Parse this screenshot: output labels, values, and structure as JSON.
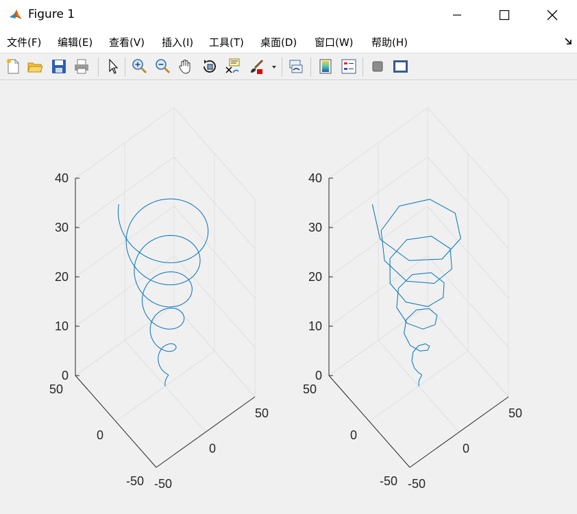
{
  "window": {
    "title": "Figure 1"
  },
  "menu": {
    "items": [
      "文件(F)",
      "编辑(E)",
      "查看(V)",
      "插入(I)",
      "工具(T)",
      "桌面(D)",
      "窗口(W)",
      "帮助(H)"
    ]
  },
  "toolbar": {
    "buttons": [
      "new-figure-icon",
      "open-file-icon",
      "save-icon",
      "print-icon",
      "select-arrow-icon",
      "zoom-in-icon",
      "zoom-out-icon",
      "pan-hand-icon",
      "rotate-3d-icon",
      "data-cursor-icon",
      "brush-icon",
      "link-plot-icon",
      "colorbar-icon",
      "legend-icon",
      "hide-plot-tools-icon",
      "show-plot-tools-icon"
    ]
  },
  "colors": {
    "line": "#0072bd",
    "axis": "#262626",
    "grid": "#dfdfdf",
    "canvas": "#f0f0f0"
  },
  "axes": [
    {
      "z_ticks": [
        "0",
        "10",
        "20",
        "30",
        "40"
      ],
      "x_ticks": [
        "-50",
        "0",
        "50"
      ],
      "y_ticks": [
        "-50",
        "0",
        "50"
      ]
    },
    {
      "z_ticks": [
        "0",
        "10",
        "20",
        "30",
        "40"
      ],
      "x_ticks": [
        "-50",
        "0",
        "50"
      ],
      "y_ticks": [
        "-50",
        "0",
        "50"
      ]
    }
  ],
  "chart_data": [
    {
      "type": "line",
      "style": "smooth helix (plot3)",
      "x_range": [
        -50,
        50
      ],
      "y_range": [
        -50,
        50
      ],
      "z_range": [
        0,
        40
      ],
      "z_ticks": [
        0,
        10,
        20,
        30,
        40
      ],
      "grid": true,
      "series_desc": "conical helix, radius grows with z",
      "t_range": [
        0,
        37
      ],
      "z_top": 35
    },
    {
      "type": "line",
      "style": "coarse helix (plot3, few samples)",
      "x_range": [
        -50,
        50
      ],
      "y_range": [
        -50,
        50
      ],
      "z_range": [
        0,
        40
      ],
      "z_ticks": [
        0,
        10,
        20,
        30,
        40
      ],
      "grid": true,
      "series_desc": "same conical helix, fewer points",
      "t_range": [
        0,
        37
      ],
      "z_top": 35
    }
  ]
}
